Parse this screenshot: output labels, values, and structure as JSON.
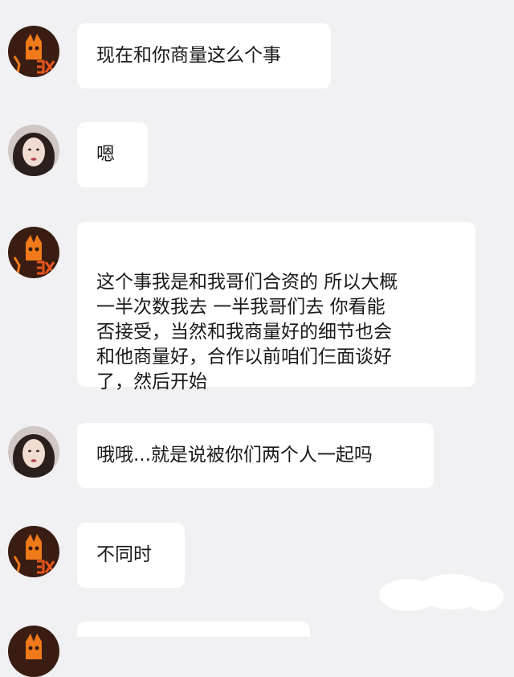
{
  "conversation": {
    "messages": [
      {
        "sender": "cat-avatar-user",
        "text": "现在和你商量这么个事"
      },
      {
        "sender": "girl-avatar-user",
        "text": "嗯"
      },
      {
        "sender": "cat-avatar-user",
        "text": "这个事我是和我哥们合资的 所以大概\n一半次数我去 一半我哥们去 你看能\n否接受，当然和我商量好的细节也会\n和他商量好，合作以前咱们仨面谈好\n了，然后开始"
      },
      {
        "sender": "girl-avatar-user",
        "text": "哦哦...就是说被你们两个人一起吗"
      },
      {
        "sender": "cat-avatar-user",
        "text": "不同时"
      },
      {
        "sender": "cat-avatar-user",
        "text": ""
      }
    ]
  },
  "colors": {
    "background": "#f1f1f3",
    "bubble": "#ffffff",
    "text": "#1a1a1a",
    "cat_avatar_bg": "#3a1d12",
    "cat_avatar_accent": "#f07a1a",
    "girl_avatar_bg": "#cfc8c4"
  }
}
